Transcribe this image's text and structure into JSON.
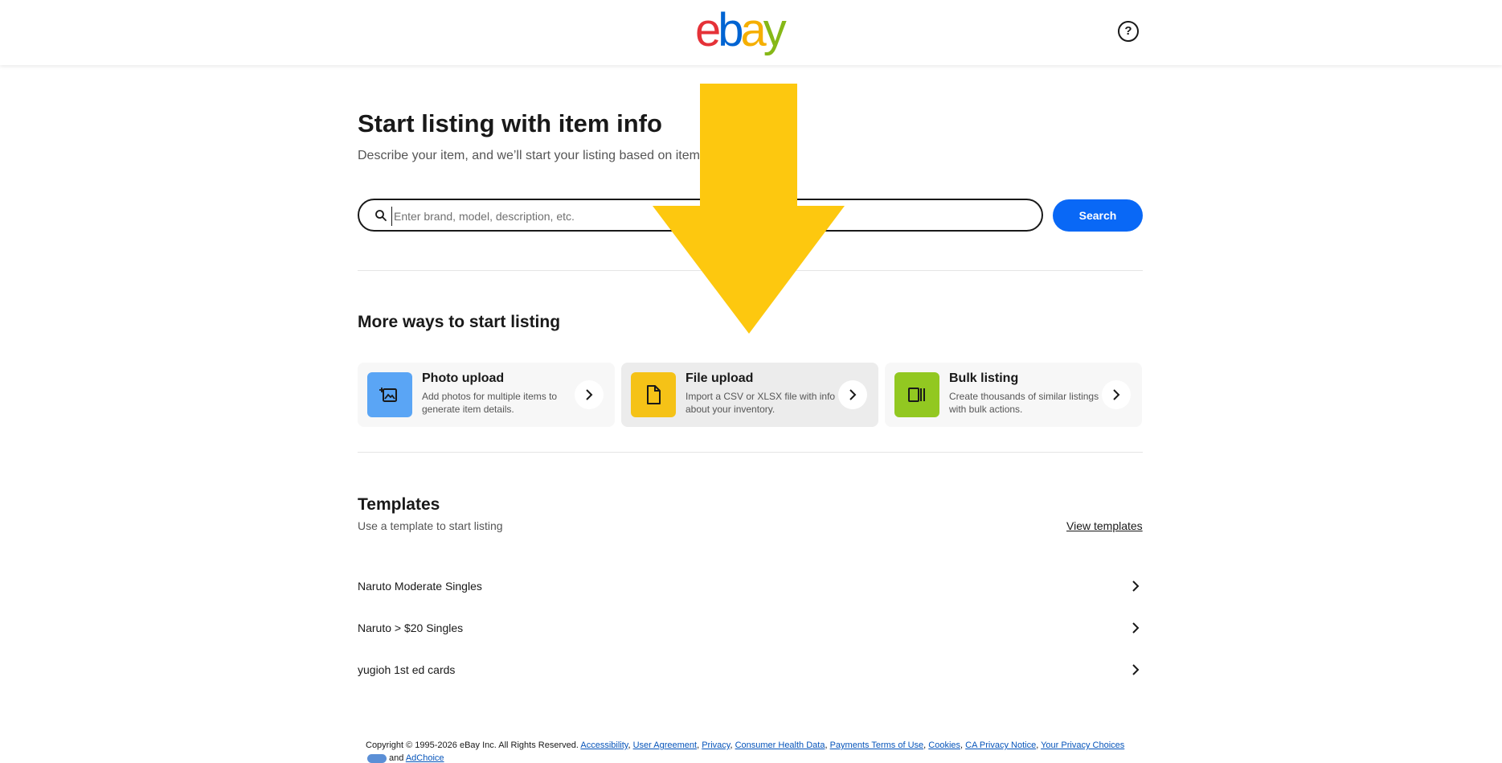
{
  "header": {
    "logo": {
      "e": "e",
      "b": "b",
      "a": "a",
      "y": "y"
    },
    "help_icon_glyph": "?"
  },
  "main": {
    "title": "Start listing with item info",
    "subtitle": "Describe your item, and we’ll start your listing based on item",
    "search": {
      "placeholder": "Enter brand, model, description, etc.",
      "button_label": "Search"
    }
  },
  "more_ways": {
    "title": "More ways to start listing",
    "cards": [
      {
        "title": "Photo upload",
        "desc": "Add photos for multiple items to generate item details.",
        "icon": "photo-icon",
        "color": "#5aa5f5"
      },
      {
        "title": "File upload",
        "desc": "Import a CSV or XLSX file with info about your inventory.",
        "icon": "file-icon",
        "color": "#f5c217"
      },
      {
        "title": "Bulk listing",
        "desc": "Create thousands of similar listings with bulk actions.",
        "icon": "bulk-icon",
        "color": "#92c821"
      }
    ]
  },
  "templates": {
    "title": "Templates",
    "subtitle": "Use a template to start listing",
    "view_link": "View templates",
    "items": [
      {
        "label": "Naruto Moderate Singles"
      },
      {
        "label": "Naruto > $20 Singles"
      },
      {
        "label": "yugioh 1st ed cards"
      }
    ]
  },
  "footer": {
    "copyright": "Copyright © 1995-2026 eBay Inc. All Rights Reserved.",
    "links": [
      "Accessibility",
      "User Agreement",
      "Privacy",
      "Consumer Health Data",
      "Payments Terms of Use",
      "Cookies",
      "CA Privacy Notice",
      "Your Privacy Choices"
    ],
    "and_text": "and",
    "adchoice": "AdChoice"
  },
  "colors": {
    "accent": "#0968f6",
    "overlay_arrow": "#fdc80f"
  }
}
